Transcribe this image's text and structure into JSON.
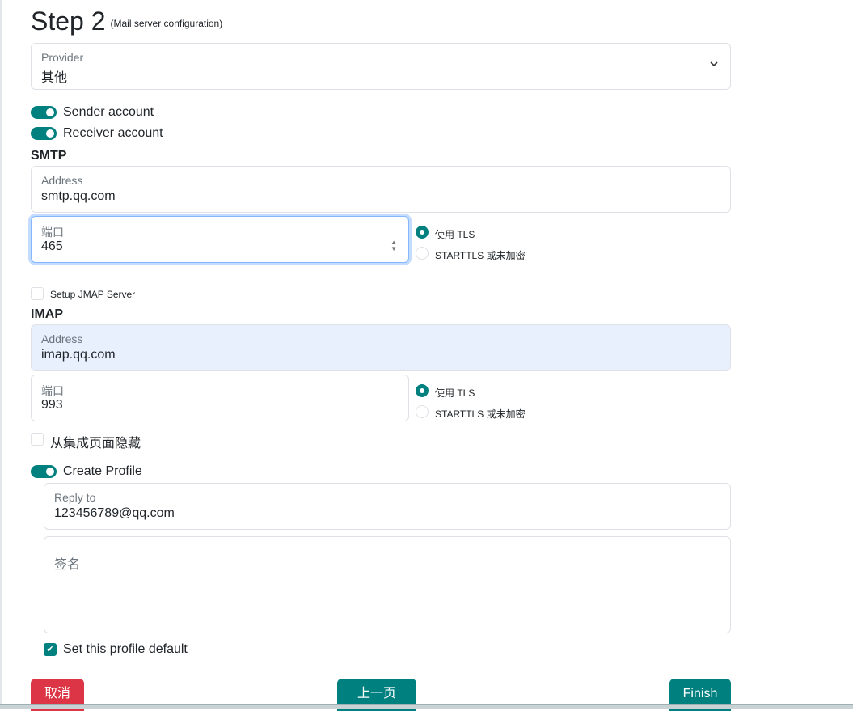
{
  "header": {
    "title": "Step 2",
    "subtitle": "(Mail server configuration)"
  },
  "provider": {
    "label": "Provider",
    "value": "其他"
  },
  "toggles": {
    "sender": "Sender account",
    "receiver": "Receiver account",
    "create_profile": "Create Profile"
  },
  "smtp": {
    "heading": "SMTP",
    "address_label": "Address",
    "address": "smtp.qq.com",
    "port_label": "端口",
    "port": "465",
    "tls": "使用 TLS",
    "starttls": "STARTTLS 或未加密"
  },
  "jmap": {
    "label": "Setup JMAP Server"
  },
  "imap": {
    "heading": "IMAP",
    "address_label": "Address",
    "address": "imap.qq.com",
    "port_label": "端口",
    "port": "993",
    "tls": "使用 TLS",
    "starttls": "STARTTLS 或未加密"
  },
  "hide": {
    "label": "从集成页面隐藏"
  },
  "profile": {
    "reply_label": "Reply to",
    "reply": "123456789@qq.com",
    "signature_placeholder": "签名",
    "default_label": "Set this profile default"
  },
  "buttons": {
    "cancel": "取消",
    "prev": "上一页",
    "finish": "Finish"
  },
  "colors": {
    "accent": "#00807f",
    "danger": "#dc3545"
  }
}
